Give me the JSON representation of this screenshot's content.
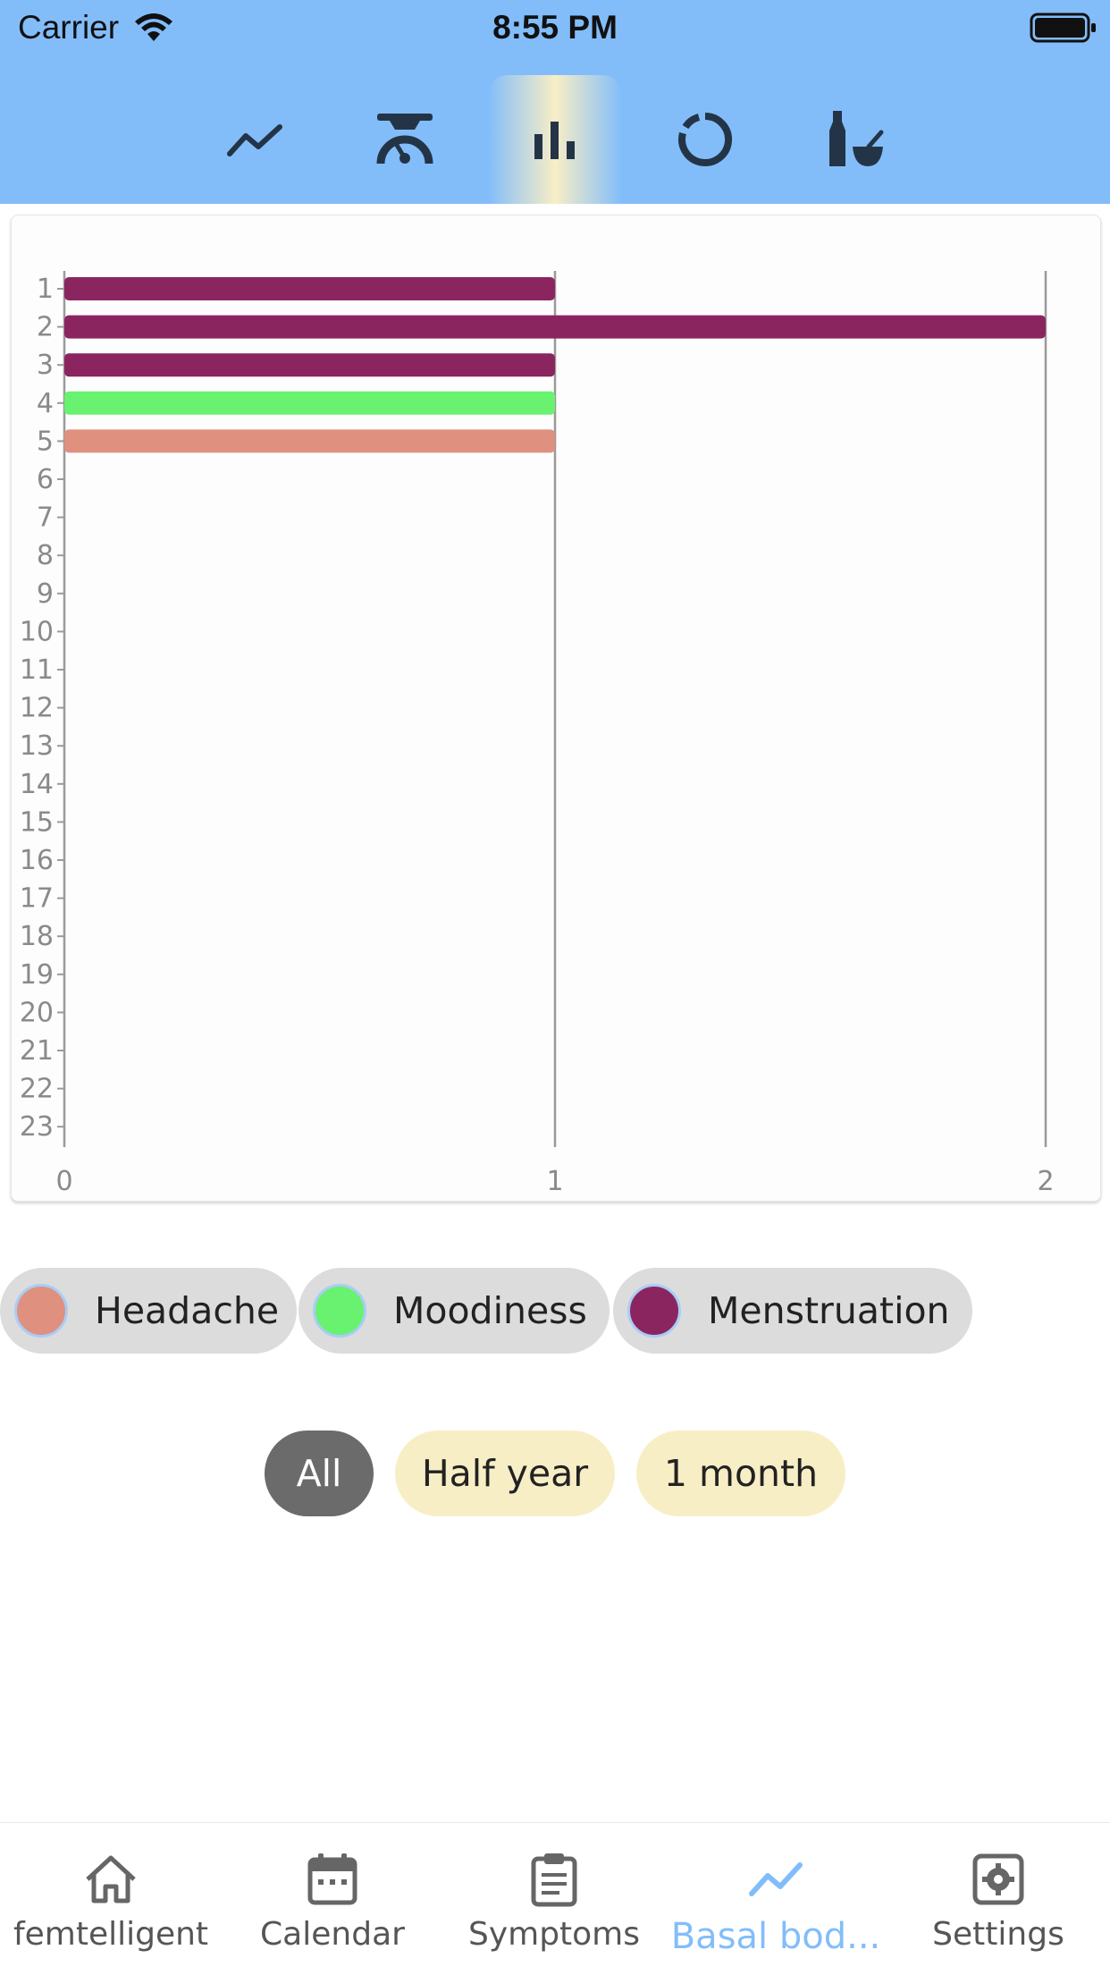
{
  "status_bar": {
    "carrier": "Carrier",
    "time": "8:55 PM"
  },
  "chart_tabs": [
    {
      "icon": "line-chart-icon",
      "active": false
    },
    {
      "icon": "gauge-icon",
      "active": false
    },
    {
      "icon": "bar-chart-icon",
      "active": true
    },
    {
      "icon": "donut-chart-icon",
      "active": false
    },
    {
      "icon": "mortar-pestle-icon",
      "active": false
    }
  ],
  "chart_data": {
    "type": "bar",
    "orientation": "horizontal",
    "categories": [
      "1",
      "2",
      "3",
      "4",
      "5",
      "6",
      "7",
      "8",
      "9",
      "10",
      "11",
      "12",
      "13",
      "14",
      "15",
      "16",
      "17",
      "18",
      "19",
      "20",
      "21",
      "22",
      "23"
    ],
    "series": [
      {
        "name": "Menstruation",
        "color": "#8b2560",
        "values": [
          1,
          2,
          1,
          0,
          0,
          0,
          0,
          0,
          0,
          0,
          0,
          0,
          0,
          0,
          0,
          0,
          0,
          0,
          0,
          0,
          0,
          0,
          0
        ]
      },
      {
        "name": "Moodiness",
        "color": "#68f26f",
        "values": [
          0,
          0,
          0,
          1,
          0,
          0,
          0,
          0,
          0,
          0,
          0,
          0,
          0,
          0,
          0,
          0,
          0,
          0,
          0,
          0,
          0,
          0,
          0
        ]
      },
      {
        "name": "Headache",
        "color": "#e0907f",
        "values": [
          0,
          0,
          0,
          0,
          1,
          0,
          0,
          0,
          0,
          0,
          0,
          0,
          0,
          0,
          0,
          0,
          0,
          0,
          0,
          0,
          0,
          0,
          0
        ]
      }
    ],
    "x_ticks": [
      "0",
      "1",
      "2"
    ],
    "xlim": [
      0,
      2
    ],
    "grid": "vertical"
  },
  "legend": [
    {
      "label": "Headache",
      "color": "#e0907f"
    },
    {
      "label": "Moodiness",
      "color": "#68f26f"
    },
    {
      "label": "Menstruation",
      "color": "#8b2560"
    }
  ],
  "range_filters": [
    {
      "label": "All",
      "selected": true
    },
    {
      "label": "Half year",
      "selected": false
    },
    {
      "label": "1 month",
      "selected": false
    }
  ],
  "tab_bar": [
    {
      "label": "femtelligent",
      "icon": "home-icon",
      "active": false
    },
    {
      "label": "Calendar",
      "icon": "calendar-icon",
      "active": false
    },
    {
      "label": "Symptoms",
      "icon": "clipboard-icon",
      "active": false
    },
    {
      "label": "Basal bod...",
      "icon": "line-chart-icon",
      "active": true
    },
    {
      "label": "Settings",
      "icon": "gear-icon",
      "active": false
    }
  ],
  "colors": {
    "header": "#82bdfa",
    "accent": "#82bdfa",
    "active_tab_highlight": "#f8eec6",
    "selected_filter": "#6b6b6b"
  }
}
